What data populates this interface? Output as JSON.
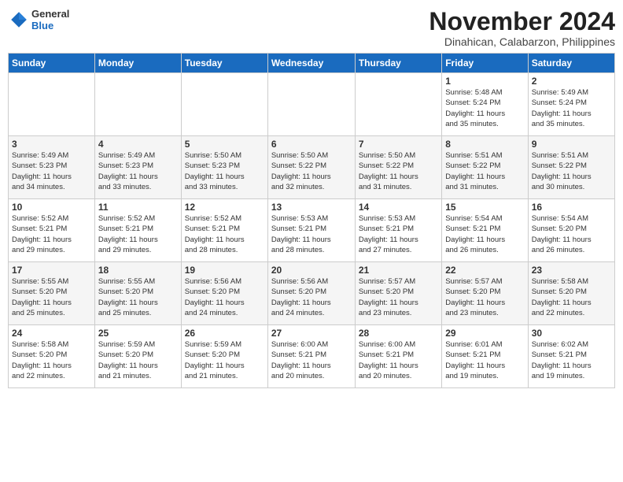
{
  "header": {
    "logo": {
      "general": "General",
      "blue": "Blue"
    },
    "title": "November 2024",
    "subtitle": "Dinahican, Calabarzon, Philippines"
  },
  "weekdays": [
    "Sunday",
    "Monday",
    "Tuesday",
    "Wednesday",
    "Thursday",
    "Friday",
    "Saturday"
  ],
  "weeks": [
    [
      {
        "day": "",
        "info": ""
      },
      {
        "day": "",
        "info": ""
      },
      {
        "day": "",
        "info": ""
      },
      {
        "day": "",
        "info": ""
      },
      {
        "day": "",
        "info": ""
      },
      {
        "day": "1",
        "info": "Sunrise: 5:48 AM\nSunset: 5:24 PM\nDaylight: 11 hours\nand 35 minutes."
      },
      {
        "day": "2",
        "info": "Sunrise: 5:49 AM\nSunset: 5:24 PM\nDaylight: 11 hours\nand 35 minutes."
      }
    ],
    [
      {
        "day": "3",
        "info": "Sunrise: 5:49 AM\nSunset: 5:23 PM\nDaylight: 11 hours\nand 34 minutes."
      },
      {
        "day": "4",
        "info": "Sunrise: 5:49 AM\nSunset: 5:23 PM\nDaylight: 11 hours\nand 33 minutes."
      },
      {
        "day": "5",
        "info": "Sunrise: 5:50 AM\nSunset: 5:23 PM\nDaylight: 11 hours\nand 33 minutes."
      },
      {
        "day": "6",
        "info": "Sunrise: 5:50 AM\nSunset: 5:22 PM\nDaylight: 11 hours\nand 32 minutes."
      },
      {
        "day": "7",
        "info": "Sunrise: 5:50 AM\nSunset: 5:22 PM\nDaylight: 11 hours\nand 31 minutes."
      },
      {
        "day": "8",
        "info": "Sunrise: 5:51 AM\nSunset: 5:22 PM\nDaylight: 11 hours\nand 31 minutes."
      },
      {
        "day": "9",
        "info": "Sunrise: 5:51 AM\nSunset: 5:22 PM\nDaylight: 11 hours\nand 30 minutes."
      }
    ],
    [
      {
        "day": "10",
        "info": "Sunrise: 5:52 AM\nSunset: 5:21 PM\nDaylight: 11 hours\nand 29 minutes."
      },
      {
        "day": "11",
        "info": "Sunrise: 5:52 AM\nSunset: 5:21 PM\nDaylight: 11 hours\nand 29 minutes."
      },
      {
        "day": "12",
        "info": "Sunrise: 5:52 AM\nSunset: 5:21 PM\nDaylight: 11 hours\nand 28 minutes."
      },
      {
        "day": "13",
        "info": "Sunrise: 5:53 AM\nSunset: 5:21 PM\nDaylight: 11 hours\nand 28 minutes."
      },
      {
        "day": "14",
        "info": "Sunrise: 5:53 AM\nSunset: 5:21 PM\nDaylight: 11 hours\nand 27 minutes."
      },
      {
        "day": "15",
        "info": "Sunrise: 5:54 AM\nSunset: 5:21 PM\nDaylight: 11 hours\nand 26 minutes."
      },
      {
        "day": "16",
        "info": "Sunrise: 5:54 AM\nSunset: 5:20 PM\nDaylight: 11 hours\nand 26 minutes."
      }
    ],
    [
      {
        "day": "17",
        "info": "Sunrise: 5:55 AM\nSunset: 5:20 PM\nDaylight: 11 hours\nand 25 minutes."
      },
      {
        "day": "18",
        "info": "Sunrise: 5:55 AM\nSunset: 5:20 PM\nDaylight: 11 hours\nand 25 minutes."
      },
      {
        "day": "19",
        "info": "Sunrise: 5:56 AM\nSunset: 5:20 PM\nDaylight: 11 hours\nand 24 minutes."
      },
      {
        "day": "20",
        "info": "Sunrise: 5:56 AM\nSunset: 5:20 PM\nDaylight: 11 hours\nand 24 minutes."
      },
      {
        "day": "21",
        "info": "Sunrise: 5:57 AM\nSunset: 5:20 PM\nDaylight: 11 hours\nand 23 minutes."
      },
      {
        "day": "22",
        "info": "Sunrise: 5:57 AM\nSunset: 5:20 PM\nDaylight: 11 hours\nand 23 minutes."
      },
      {
        "day": "23",
        "info": "Sunrise: 5:58 AM\nSunset: 5:20 PM\nDaylight: 11 hours\nand 22 minutes."
      }
    ],
    [
      {
        "day": "24",
        "info": "Sunrise: 5:58 AM\nSunset: 5:20 PM\nDaylight: 11 hours\nand 22 minutes."
      },
      {
        "day": "25",
        "info": "Sunrise: 5:59 AM\nSunset: 5:20 PM\nDaylight: 11 hours\nand 21 minutes."
      },
      {
        "day": "26",
        "info": "Sunrise: 5:59 AM\nSunset: 5:20 PM\nDaylight: 11 hours\nand 21 minutes."
      },
      {
        "day": "27",
        "info": "Sunrise: 6:00 AM\nSunset: 5:21 PM\nDaylight: 11 hours\nand 20 minutes."
      },
      {
        "day": "28",
        "info": "Sunrise: 6:00 AM\nSunset: 5:21 PM\nDaylight: 11 hours\nand 20 minutes."
      },
      {
        "day": "29",
        "info": "Sunrise: 6:01 AM\nSunset: 5:21 PM\nDaylight: 11 hours\nand 19 minutes."
      },
      {
        "day": "30",
        "info": "Sunrise: 6:02 AM\nSunset: 5:21 PM\nDaylight: 11 hours\nand 19 minutes."
      }
    ]
  ]
}
